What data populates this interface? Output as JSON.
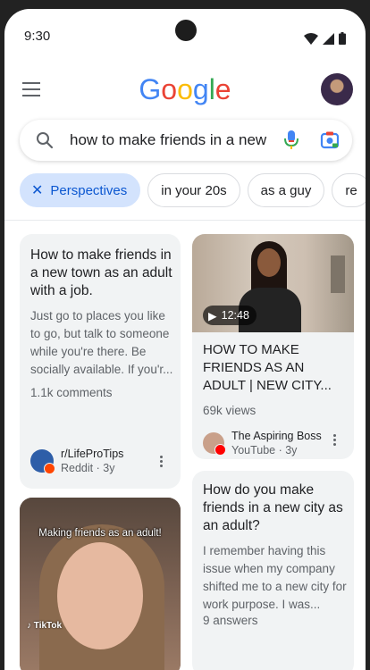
{
  "status": {
    "time": "9:30"
  },
  "header": {
    "logo_letters": [
      {
        "ch": "G",
        "color": "#4285F4"
      },
      {
        "ch": "o",
        "color": "#EA4335"
      },
      {
        "ch": "o",
        "color": "#FBBC05"
      },
      {
        "ch": "g",
        "color": "#4285F4"
      },
      {
        "ch": "l",
        "color": "#34A853"
      },
      {
        "ch": "e",
        "color": "#EA4335"
      }
    ]
  },
  "search": {
    "query": "how to make friends in a new"
  },
  "chips": {
    "perspectives": "Perspectives",
    "in_your_20s": "in your 20s",
    "as_a_guy": "as a guy",
    "partial": "re"
  },
  "cards": {
    "reddit": {
      "title": "How to make friends in a new town as an adult with a job.",
      "snippet": "Just go to places you like to go, but talk to someone while you're there. Be socially available. If you'r...",
      "meta": "1.1k comments",
      "source_name": "r/LifeProTips",
      "source_sub": "Reddit · 3y"
    },
    "youtube": {
      "duration": "12:48",
      "title": "HOW TO MAKE FRIENDS AS AN ADULT | NEW CITY...",
      "meta": "69k views",
      "source_name": "The Aspiring Boss",
      "source_sub": "YouTube · 3y"
    },
    "tiktok": {
      "overlay": "Making friends as an adult!",
      "brand": "TikTok"
    },
    "quora": {
      "title": "How do you make friends in a new city as an adult?",
      "snippet": "I remember having this issue when my company shifted me to a new city for work purpose. I was...",
      "meta": "9 answers"
    }
  },
  "colors": {
    "chip_active_bg": "#d3e3fd",
    "chip_active_text": "#0b57d0",
    "card_bg": "#f1f3f4",
    "youtube_red": "#ff0000",
    "reddit_orange": "#ff4500"
  }
}
